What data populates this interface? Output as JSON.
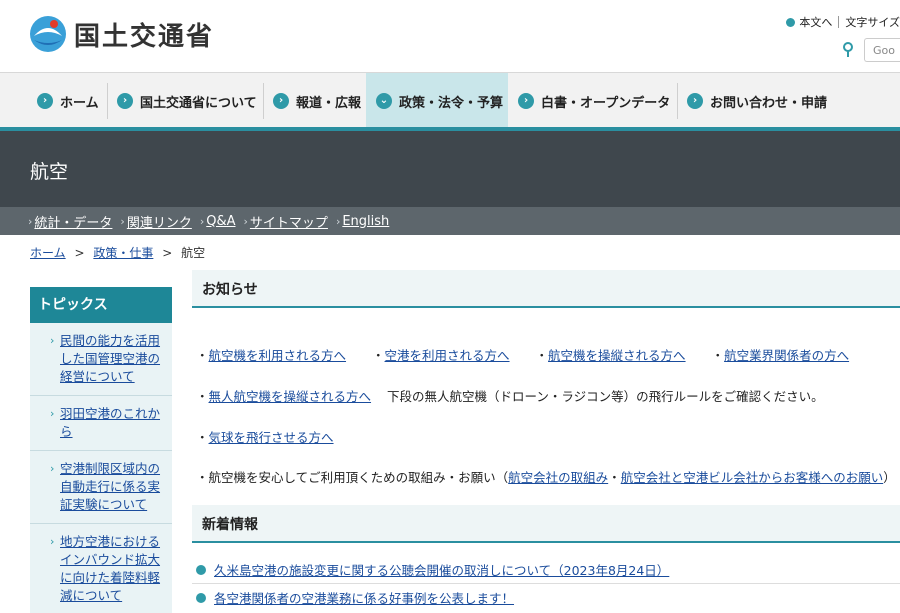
{
  "header": {
    "logo_text": "国土交通省",
    "util_honbun": "本文へ",
    "util_moji": "文字サイズ",
    "search_placeholder": "Goo"
  },
  "gnav": {
    "items": [
      {
        "label": "ホーム"
      },
      {
        "label": "国土交通省について"
      },
      {
        "label": "報道・広報"
      },
      {
        "label": "政策・法令・予算"
      },
      {
        "label": "白書・オープンデータ"
      },
      {
        "label": "お問い合わせ・申請"
      }
    ]
  },
  "banner": {
    "title": "航空"
  },
  "subnav": {
    "links": [
      "統計・データ",
      "関連リンク",
      "Q&A",
      "サイトマップ",
      "English"
    ]
  },
  "breadcrumb": {
    "home": "ホーム",
    "policy": "政策・仕事",
    "current": "航空",
    "sep": ">"
  },
  "sidebar": {
    "title": "トピックス",
    "items": [
      "民間の能力を活用した国管理空港の経営について",
      "羽田空港のこれから",
      "空港制限区域内の自動走行に係る実証実験について",
      "地方空港におけるインバウンド拡大に向けた着陸料軽減について"
    ]
  },
  "oshirase": {
    "title": "お知らせ",
    "row1": [
      "航空機を利用される方へ",
      "空港を利用される方へ",
      "航空機を操縦される方へ",
      "航空業界関係者の方へ"
    ],
    "drone_link": "無人航空機を操縦される方へ",
    "drone_text": "下段の無人航空機（ドローン・ラジコン等）の飛行ルールをご確認ください。",
    "balloon_link": "気球を飛行させる方へ",
    "safety_text": "航空機を安心してご利用頂くための取組み・お願い（",
    "safety_link1": "航空会社の取組み",
    "safety_mid": "・",
    "safety_link2": "航空会社と空港ビル会社からお客様へのお願い",
    "safety_end": "）",
    "bullet": "・"
  },
  "news": {
    "title": "新着情報",
    "items": [
      "久米島空港の施設変更に関する公聴会開催の取消しについて（2023年8月24日）",
      "各空港関係者の空港業務に係る好事例を公表します！"
    ]
  },
  "colors": {
    "accent": "#2a8fa0",
    "banner": "#3f474d",
    "subnav": "#5d666c",
    "link": "#1a4c9c"
  }
}
